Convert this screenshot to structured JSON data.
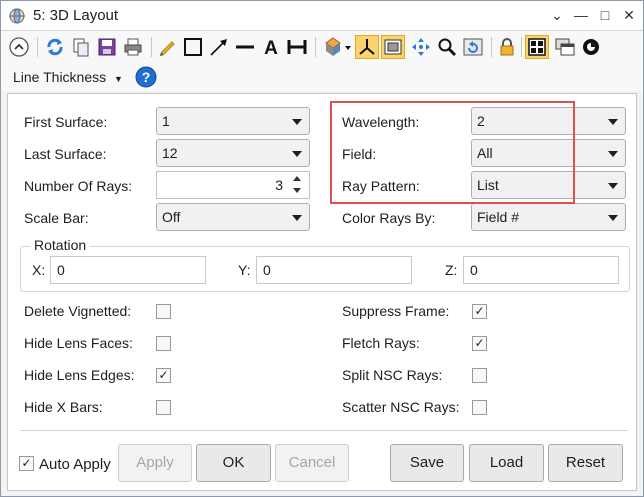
{
  "window": {
    "title": "5: 3D Layout"
  },
  "toolbar": {
    "line_thickness_label": "Line Thickness"
  },
  "settings": {
    "first_surface": {
      "label": "First Surface:",
      "value": "1"
    },
    "last_surface": {
      "label": "Last Surface:",
      "value": "12"
    },
    "number_of_rays": {
      "label": "Number Of Rays:",
      "value": "3"
    },
    "scale_bar": {
      "label": "Scale Bar:",
      "value": "Off"
    },
    "wavelength": {
      "label": "Wavelength:",
      "value": "2"
    },
    "field": {
      "label": "Field:",
      "value": "All"
    },
    "ray_pattern": {
      "label": "Ray Pattern:",
      "value": "List"
    },
    "color_rays_by": {
      "label": "Color Rays By:",
      "value": "Field #"
    }
  },
  "rotation": {
    "title": "Rotation",
    "x": {
      "label": "X:",
      "value": "0"
    },
    "y": {
      "label": "Y:",
      "value": "0"
    },
    "z": {
      "label": "Z:",
      "value": "0"
    }
  },
  "checkboxes": {
    "delete_vignetted": {
      "label": "Delete Vignetted:",
      "checked": false
    },
    "hide_lens_faces": {
      "label": "Hide Lens Faces:",
      "checked": false
    },
    "hide_lens_edges": {
      "label": "Hide Lens Edges:",
      "checked": true
    },
    "hide_x_bars": {
      "label": "Hide X Bars:",
      "checked": false
    },
    "suppress_frame": {
      "label": "Suppress Frame:",
      "checked": true
    },
    "fletch_rays": {
      "label": "Fletch Rays:",
      "checked": true
    },
    "split_nsc_rays": {
      "label": "Split NSC Rays:",
      "checked": false
    },
    "scatter_nsc_rays": {
      "label": "Scatter NSC Rays:",
      "checked": false
    }
  },
  "footer": {
    "auto_apply": {
      "label": "Auto Apply",
      "checked": true
    },
    "apply": "Apply",
    "ok": "OK",
    "cancel": "Cancel",
    "save": "Save",
    "load": "Load",
    "reset": "Reset"
  },
  "colors": {
    "highlight": "#d9534f",
    "active_tool": "#fbd36f",
    "accent_blue": "#1e6fd0"
  }
}
